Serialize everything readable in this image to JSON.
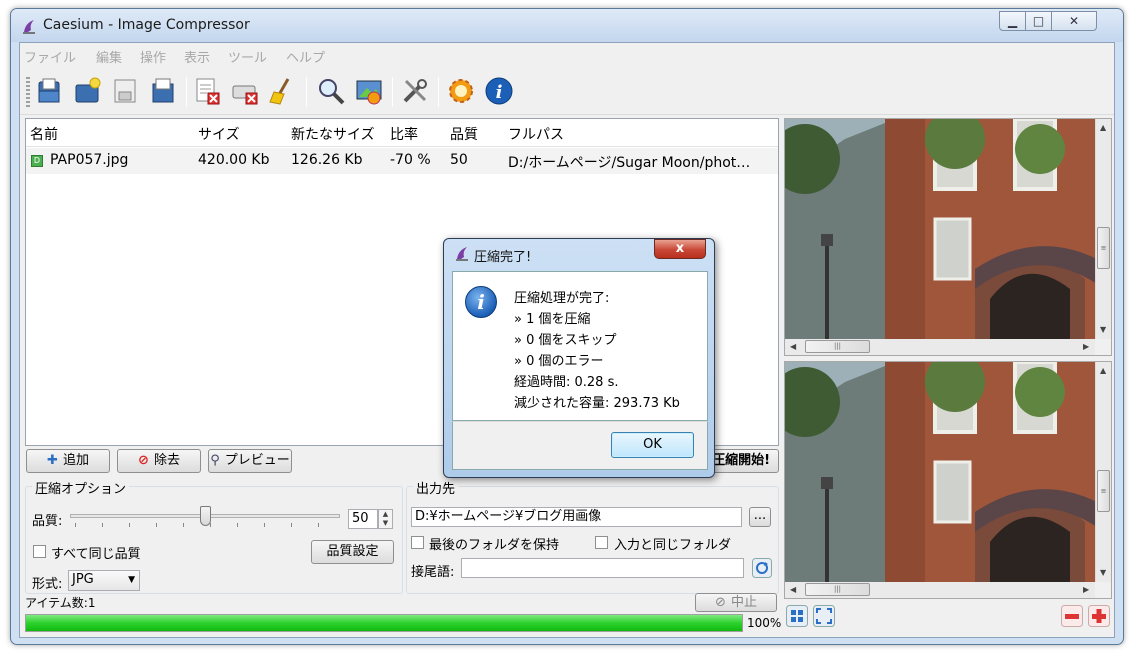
{
  "window": {
    "title": "Caesium - Image Compressor",
    "min_label": "▁",
    "max_label": "□",
    "close_label": "✕"
  },
  "menu": [
    "ファイル",
    "編集",
    "操作",
    "表示",
    "ツール",
    "ヘルプ"
  ],
  "toolbar": [
    "open-file-icon",
    "open-folder-icon",
    "save-list-icon",
    "export-list-icon",
    "remove-item-icon",
    "clear-list-icon",
    "clean-icon",
    "preview-zoom-icon",
    "image-preview-icon",
    "settings-tools-icon",
    "update-icon",
    "about-info-icon"
  ],
  "list": {
    "columns": [
      "名前",
      "サイズ",
      "新たなサイズ",
      "比率",
      "品質",
      "フルパス"
    ],
    "rows": [
      {
        "name": "PAP057.jpg",
        "size": "420.00 Kb",
        "new_size": "126.26 Kb",
        "ratio": "-70 %",
        "quality": "50",
        "path": "D:/ホームページ/Sugar Moon/phot…"
      }
    ]
  },
  "buttons": {
    "add": "追加",
    "remove": "除去",
    "preview": "プレビュー",
    "compress": "圧縮開始!"
  },
  "options": {
    "group_label": "圧縮オプション",
    "quality_label": "品質:",
    "quality_value": "50",
    "slider_level": 0.5,
    "same_quality_label": "すべて同じ品質",
    "quality_settings_button": "品質設定",
    "format_label": "形式:",
    "format_value": "JPG"
  },
  "output": {
    "group_label": "出力先",
    "path_value": "D:¥ホームページ¥ブログ用画像",
    "browse_button": "...",
    "keep_structure_label": "最後のフォルダを保持",
    "same_as_input_label": "入力と同じフォルダ",
    "suffix_label": "接尾語:",
    "suffix_value": ""
  },
  "status": {
    "items_label": "アイテム数:1",
    "stop_button": "中止",
    "progress_text": "100%",
    "progress_fraction": 1.0
  },
  "dialog": {
    "title": "圧縮完了!",
    "close_label": "x",
    "lines": [
      "圧縮処理が完了:",
      "» 1 個を圧縮",
      "» 0 個をスキップ",
      "» 0 個のエラー",
      "経過時間: 0.28 s.",
      "減少された容量: 293.73 Kb"
    ],
    "ok_button": "OK",
    "icon": "information-icon"
  },
  "colors": {
    "progress_green": "#22c922",
    "accent_blue": "#1c5fb6"
  }
}
